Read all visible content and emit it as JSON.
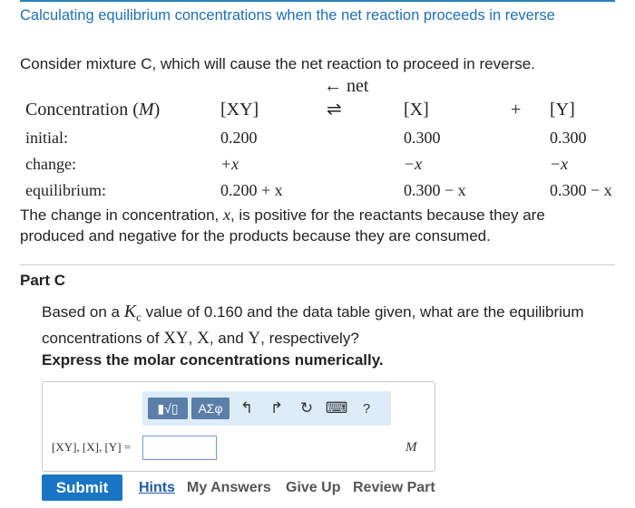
{
  "header": {
    "title": "Calculating equilibrium concentrations when the net reaction proceeds in reverse"
  },
  "intro_text": "Consider mixture C, which will cause the net reaction to proceed in reverse.",
  "table": {
    "direction_label": "← net",
    "header_label": "Concentration (",
    "header_unit": "M",
    "header_close": ")",
    "species_reactant": "[XY]",
    "equilibrium_arrow": "⇌",
    "species_product1": "[X]",
    "plus": "+",
    "species_product2": "[Y]",
    "rows": [
      {
        "label": "initial:",
        "c1": "0.200",
        "c2": "0.300",
        "c3": "0.300"
      },
      {
        "label": "change:",
        "c1": "+x",
        "c2": "−x",
        "c3": "−x"
      },
      {
        "label": "equilibrium:",
        "c1": "0.200 + x",
        "c2": "0.300 − x",
        "c3": "0.300 − x"
      }
    ]
  },
  "explanation": {
    "before": "The change in concentration, ",
    "var": "x",
    "after": ", is positive for the reactants because they are produced and negative for the products because they are consumed."
  },
  "part": {
    "title": "Part C",
    "question": {
      "q1": "Based on a ",
      "k": "K",
      "k_sub": "c",
      "q2": " value of 0.160 and the data table given, what are the equilibrium concentrations of ",
      "s1": "XY",
      "q3": ", ",
      "s2": "X",
      "q4": ", and ",
      "s3": "Y",
      "q5": ", respectively?"
    },
    "instruction": "Express the molar concentrations numerically."
  },
  "toolbar": {
    "template_btn": "▮√▯",
    "greek_btn": "ΑΣφ",
    "undo_icon": "↰",
    "redo_icon": "↱",
    "reset_icon": "↻",
    "keyboard_icon": "⌨",
    "help_icon": "?"
  },
  "answer": {
    "label": "[XY], [X], [Y] =",
    "value": "",
    "unit": "M"
  },
  "actions": {
    "submit": "Submit",
    "hints": "Hints",
    "my_answers": "My Answers",
    "give_up": "Give Up",
    "review_part": "Review Part"
  },
  "colors": {
    "title": "#1e6fb8",
    "submit_bg": "#1a76c4",
    "toolbar_bg": "#dcecf8",
    "toolbar_btn": "#5b7ea8"
  }
}
